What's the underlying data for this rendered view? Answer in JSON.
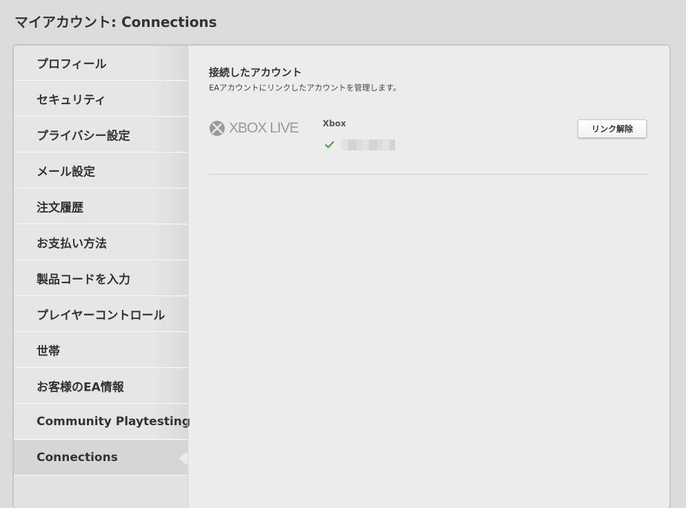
{
  "page": {
    "title": "マイアカウント: Connections"
  },
  "sidebar": {
    "items": [
      {
        "label": "プロフィール",
        "active": false
      },
      {
        "label": "セキュリティ",
        "active": false
      },
      {
        "label": "プライバシー設定",
        "active": false
      },
      {
        "label": "メール設定",
        "active": false
      },
      {
        "label": "注文履歴",
        "active": false
      },
      {
        "label": "お支払い方法",
        "active": false
      },
      {
        "label": "製品コードを入力",
        "active": false
      },
      {
        "label": "プレイヤーコントロール",
        "active": false
      },
      {
        "label": "世帯",
        "active": false
      },
      {
        "label": "お客様のEA情報",
        "active": false
      },
      {
        "label": "Community Playtesting",
        "active": false
      },
      {
        "label": "Connections",
        "active": true
      }
    ]
  },
  "main": {
    "section_title": "接続したアカウント",
    "section_description": "EAアカウントにリンクしたアカウントを管理します。",
    "connection": {
      "logo_text": "XBOX LIVE",
      "logo_icon": "xbox-icon",
      "platform": "Xbox",
      "status_icon": "checkmark-icon",
      "status_color": "#2f9e2f",
      "unlink_label": "リンク解除"
    }
  }
}
